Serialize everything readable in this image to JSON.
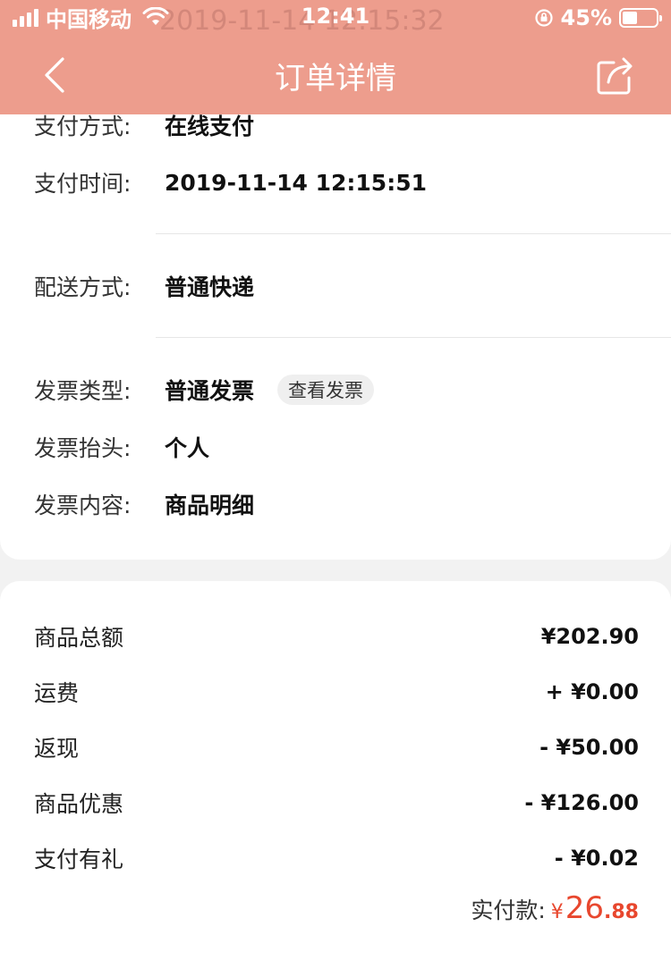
{
  "status_bar": {
    "carrier": "中国移动",
    "time": "12:41",
    "battery": "45%",
    "battery_level": 0.45,
    "ghost_text": "2019-11-14 12:15:32"
  },
  "nav": {
    "title": "订单详情",
    "back_icon": "chevron-left-icon",
    "share_icon": "share-icon"
  },
  "order_info": {
    "payment_method": {
      "label": "支付方式:",
      "value": "在线支付"
    },
    "payment_time": {
      "label": "支付时间:",
      "value": "2019-11-14 12:15:51"
    },
    "delivery_method": {
      "label": "配送方式:",
      "value": "普通快递"
    },
    "invoice_type": {
      "label": "发票类型:",
      "value": "普通发票",
      "button": "查看发票"
    },
    "invoice_title": {
      "label": "发票抬头:",
      "value": "个人"
    },
    "invoice_content": {
      "label": "发票内容:",
      "value": "商品明细"
    }
  },
  "amounts": {
    "items": [
      {
        "label": "商品总额",
        "value": "¥202.90"
      },
      {
        "label": "运费",
        "value": "+ ¥0.00"
      },
      {
        "label": "返现",
        "value": "- ¥50.00"
      },
      {
        "label": "商品优惠",
        "value": "- ¥126.00"
      },
      {
        "label": "支付有礼",
        "value": "- ¥0.02"
      }
    ],
    "total_label": "实付款:",
    "total_currency": "¥",
    "total_integer": "26",
    "total_decimal": ".88"
  },
  "colors": {
    "header_bg": "#ed9d8d",
    "price_accent": "#e8472e",
    "page_bg": "#f2f2f2"
  }
}
